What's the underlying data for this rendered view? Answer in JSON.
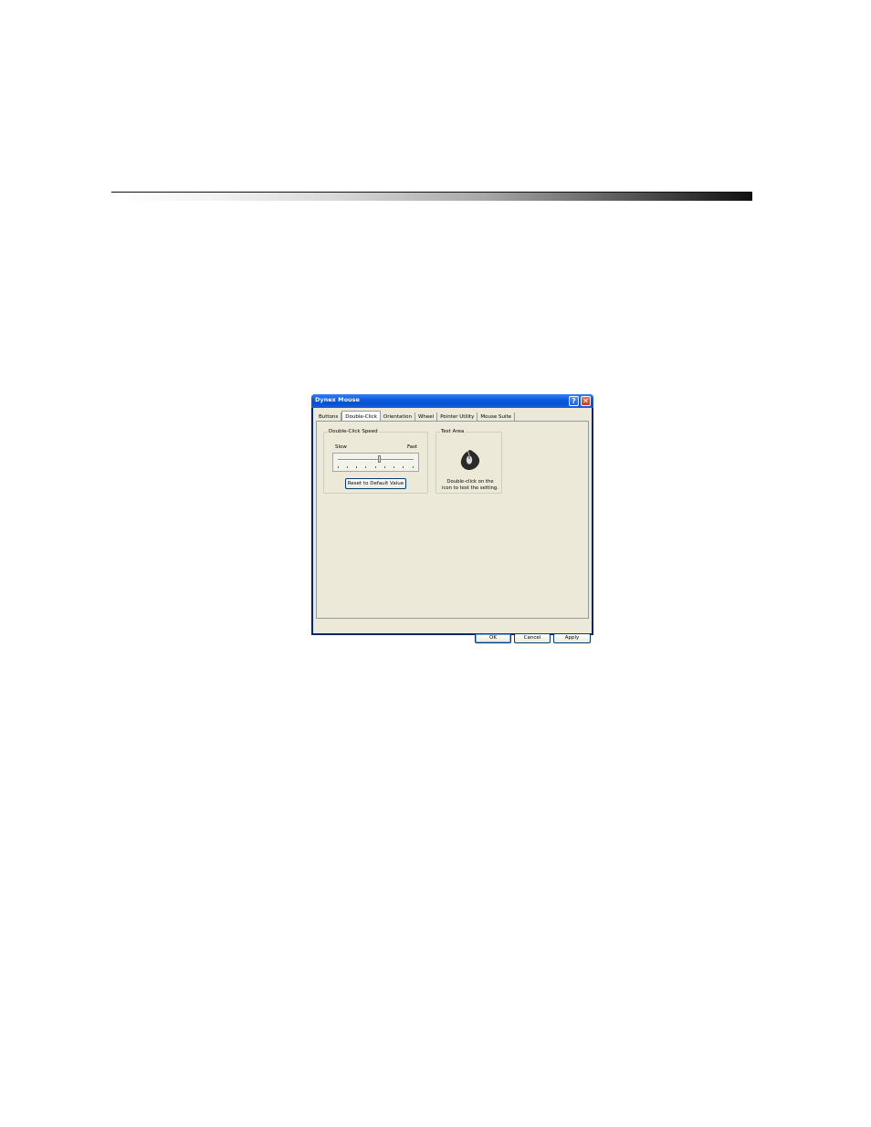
{
  "window": {
    "title": "Dynex Mouse"
  },
  "tabs": [
    "Buttons",
    "Double-Click",
    "Orientation",
    "Wheel",
    "Pointer Utility",
    "Mouse Suite"
  ],
  "active_tab": "Double-Click",
  "double_click_group": {
    "label": "Double-Click Speed",
    "slow_label": "Slow",
    "fast_label": "Fast",
    "slider_position_fraction": 0.55,
    "reset_button": "Reset to Default Value"
  },
  "test_group": {
    "label": "Test Area",
    "icon": "mouse-icon",
    "instruction_line1": "Double-click on the",
    "instruction_line2": "icon to test the setting."
  },
  "footer": {
    "ok": "OK",
    "cancel": "Cancel",
    "apply": "Apply"
  }
}
